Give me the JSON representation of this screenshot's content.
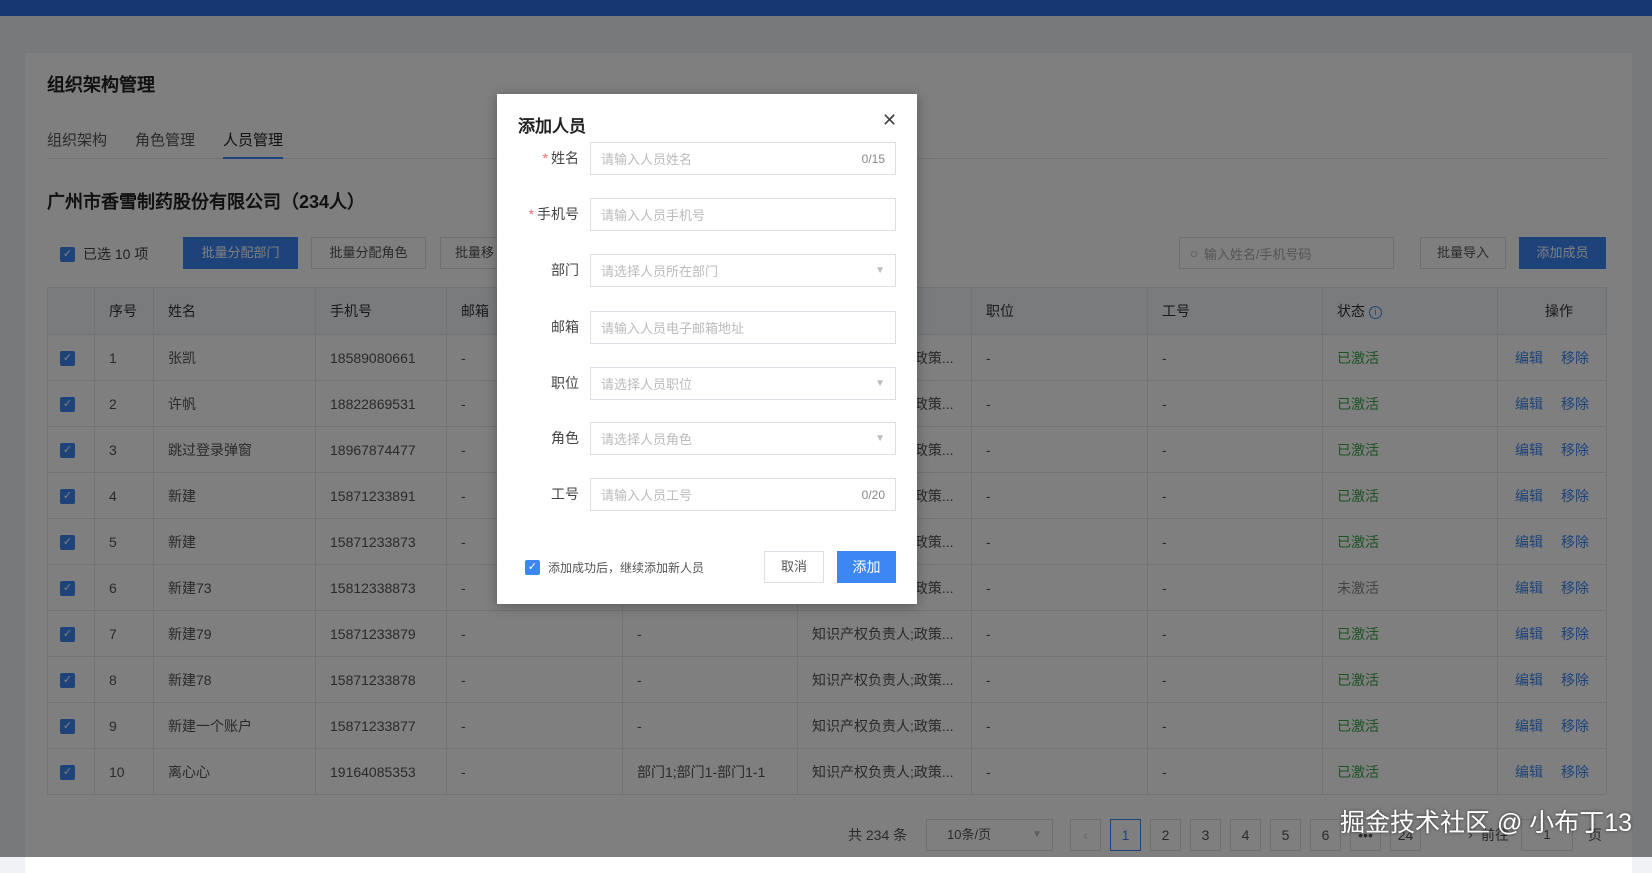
{
  "page": {
    "title": "组织架构管理",
    "tabs": [
      "组织架构",
      "角色管理",
      "人员管理"
    ],
    "active_tab": 2,
    "company": "广州市香雪制药股份有限公司（234人）"
  },
  "toolbar": {
    "selected": "已选 10 项",
    "assign_dept": "批量分配部门",
    "assign_role": "批量分配角色",
    "batch_move": "批量移",
    "search_placeholder": "输入姓名/手机号码",
    "import": "批量导入",
    "add_member": "添加成员"
  },
  "table": {
    "headers": [
      "",
      "序号",
      "姓名",
      "手机号",
      "邮箱",
      "",
      "",
      "职位",
      "工号",
      "状态",
      "操作"
    ],
    "rows": [
      [
        "1",
        "张凯",
        "18589080661",
        "-",
        "-",
        "知识产权负责人;政策...",
        "-",
        "-",
        "已激活"
      ],
      [
        "2",
        "许帆",
        "18822869531",
        "-",
        "-",
        "知识产权负责人;政策...",
        "-",
        "-",
        "已激活"
      ],
      [
        "3",
        "跳过登录弹窗",
        "18967874477",
        "-",
        "-",
        "知识产权负责人;政策...",
        "-",
        "-",
        "已激活"
      ],
      [
        "4",
        "新建",
        "15871233891",
        "-",
        "-",
        "知识产权负责人;政策...",
        "-",
        "-",
        "已激活"
      ],
      [
        "5",
        "新建",
        "15871233873",
        "-",
        "-",
        "知识产权负责人;政策...",
        "-",
        "-",
        "已激活"
      ],
      [
        "6",
        "新建73",
        "15812338873",
        "-",
        "-",
        "知识产权负责人;政策...",
        "-",
        "-",
        "未激活"
      ],
      [
        "7",
        "新建79",
        "15871233879",
        "-",
        "-",
        "知识产权负责人;政策...",
        "-",
        "-",
        "已激活"
      ],
      [
        "8",
        "新建78",
        "15871233878",
        "-",
        "-",
        "知识产权负责人;政策...",
        "-",
        "-",
        "已激活"
      ],
      [
        "9",
        "新建一个账户",
        "15871233877",
        "-",
        "-",
        "知识产权负责人;政策...",
        "-",
        "-",
        "已激活"
      ],
      [
        "10",
        "离心心",
        "19164085353",
        "-",
        "部门1;部门1-部门1-1",
        "知识产权负责人;政策...",
        "-",
        "-",
        "已激活"
      ]
    ],
    "edit": "编辑",
    "remove": "移除"
  },
  "pagination": {
    "total": "共 234 条",
    "page_size": "10条/页",
    "pages": [
      "1",
      "2",
      "3",
      "4",
      "5",
      "6",
      "•••",
      "24"
    ],
    "current": "1",
    "goto": "前往",
    "goto_value": "1",
    "page_suffix": "页"
  },
  "dialog": {
    "title": "添加人员",
    "fields": [
      {
        "label": "姓名",
        "required": true,
        "placeholder": "请输入人员姓名",
        "counter": "0/15"
      },
      {
        "label": "手机号",
        "required": true,
        "placeholder": "请输入人员手机号"
      },
      {
        "label": "部门",
        "placeholder": "请选择人员所在部门",
        "select": true
      },
      {
        "label": "邮箱",
        "placeholder": "请输入人员电子邮箱地址"
      },
      {
        "label": "职位",
        "placeholder": "请选择人员职位",
        "select": true
      },
      {
        "label": "角色",
        "placeholder": "请选择人员角色",
        "select": true
      },
      {
        "label": "工号",
        "placeholder": "请输入人员工号",
        "counter": "0/20"
      }
    ],
    "continue_label": "添加成功后，继续添加新人员",
    "cancel": "取消",
    "submit": "添加"
  },
  "watermark": "掘金技术社区 @ 小布丁13"
}
